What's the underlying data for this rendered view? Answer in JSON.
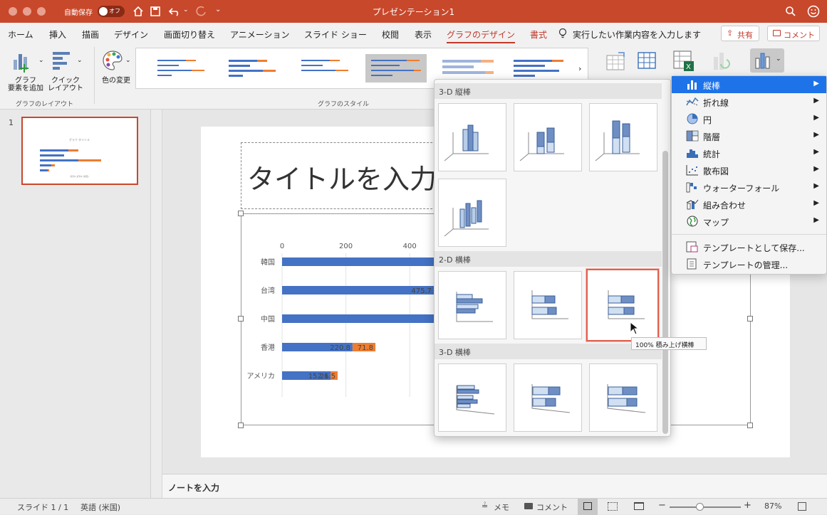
{
  "titlebar": {
    "autosave_label": "自動保存",
    "autosave_state": "オフ",
    "doc_title": "プレゼンテーション1"
  },
  "tabs": [
    "ホーム",
    "挿入",
    "描画",
    "デザイン",
    "画面切り替え",
    "アニメーション",
    "スライド ショー",
    "校閲",
    "表示",
    "グラフのデザイン",
    "書式"
  ],
  "active_tab": "グラフのデザイン",
  "tell_me": "実行したい作業内容を入力します",
  "share_label": "共有",
  "comment_label": "コメント",
  "ribbon": {
    "add_element": "グラフ\n要素を追加",
    "quick_layout": "クイック\nレイアウト",
    "change_color": "色の変更",
    "group_layout": "グラフのレイアウト",
    "group_styles": "グラフのスタイル"
  },
  "slide_thumb": {
    "number": "1",
    "title": "グラフ タイトル",
    "axis": "系列1 系列2 (米国)"
  },
  "slide": {
    "title_placeholder": "タイトルを入力"
  },
  "chart_data": {
    "type": "bar",
    "orientation": "horizontal",
    "stacked": true,
    "categories": [
      "韓国",
      "台湾",
      "中国",
      "香港",
      "アメリカ"
    ],
    "x_ticks": [
      "0",
      "200",
      "400"
    ],
    "xlim": [
      0,
      1400
    ],
    "series": [
      {
        "name": "",
        "color": "#4472c4",
        "values": [
          560,
          475.7,
          760,
          220.8,
          152.6
        ],
        "labels": [
          "",
          "475.7",
          "",
          "220.8",
          "152.6"
        ]
      },
      {
        "name": "",
        "color": "#ed7d31",
        "values": [
          0,
          0,
          455,
          71.8,
          21.5
        ],
        "labels": [
          "",
          "",
          "455",
          "71.8",
          "21.5"
        ]
      }
    ]
  },
  "gallery": {
    "sections": [
      {
        "title": "3-D 縦棒",
        "count": 4
      },
      {
        "title": "2-D 横棒",
        "count": 3
      },
      {
        "title": "3-D 横棒",
        "count": 3
      }
    ],
    "tooltip": "100% 積み上げ横棒"
  },
  "menu": {
    "items": [
      {
        "label": "縦棒",
        "icon": "column-chart-icon",
        "arrow": "▶"
      },
      {
        "label": "折れ線",
        "icon": "line-chart-icon",
        "arrow": "▶"
      },
      {
        "label": "円",
        "icon": "pie-chart-icon",
        "arrow": "▶"
      },
      {
        "label": "階層",
        "icon": "treemap-icon",
        "arrow": "▶"
      },
      {
        "label": "統計",
        "icon": "histogram-icon",
        "arrow": "▶"
      },
      {
        "label": "散布図",
        "icon": "scatter-chart-icon",
        "arrow": "▶"
      },
      {
        "label": "ウォーターフォール",
        "icon": "waterfall-icon",
        "arrow": "▶"
      },
      {
        "label": "組み合わせ",
        "icon": "combo-chart-icon",
        "arrow": "▶"
      },
      {
        "label": "マップ",
        "icon": "map-chart-icon",
        "arrow": "▶"
      }
    ],
    "save_template": "テンプレートとして保存...",
    "manage_templates": "テンプレートの管理..."
  },
  "notes_placeholder": "ノートを入力",
  "status": {
    "slide": "スライド 1 / 1",
    "language": "英語 (米国)",
    "notes": "メモ",
    "comments": "コメント",
    "zoom": "87%"
  },
  "colors": {
    "accent": "#c8482b",
    "series1": "#4472c4",
    "series2": "#ed7d31",
    "highlight": "#1e73e8"
  }
}
